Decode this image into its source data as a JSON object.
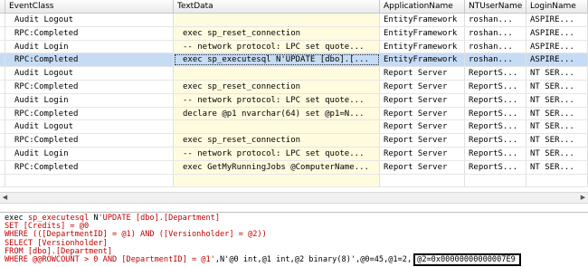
{
  "columns": [
    "EventClass",
    "TextData",
    "ApplicationName",
    "NTUserName",
    "LoginName"
  ],
  "rows": [
    {
      "event": "Audit Logout",
      "text": "",
      "app": "EntityFramework",
      "user": "roshan...",
      "login": "ASPIRE..."
    },
    {
      "event": "RPC:Completed",
      "text": "exec sp_reset_connection",
      "app": "EntityFramework",
      "user": "roshan...",
      "login": "ASPIRE..."
    },
    {
      "event": "Audit Login",
      "text": "-- network protocol: LPC  set quote...",
      "app": "EntityFramework",
      "user": "roshan...",
      "login": "ASPIRE..."
    },
    {
      "event": "RPC:Completed",
      "text": "exec sp_executesql N'UPDATE [dbo].[...",
      "app": "EntityFramework",
      "user": "roshan...",
      "login": "ASPIRE..."
    },
    {
      "event": "Audit Logout",
      "text": "",
      "app": "Report Server",
      "user": "ReportS...",
      "login": "NT SER..."
    },
    {
      "event": "RPC:Completed",
      "text": "exec sp_reset_connection",
      "app": "Report Server",
      "user": "ReportS...",
      "login": "NT SER..."
    },
    {
      "event": "Audit Login",
      "text": "-- network protocol: LPC  set quote...",
      "app": "Report Server",
      "user": "ReportS...",
      "login": "NT SER..."
    },
    {
      "event": "RPC:Completed",
      "text": "declare @p1 nvarchar(64)  set @p1=N...",
      "app": "Report Server",
      "user": "ReportS...",
      "login": "NT SER..."
    },
    {
      "event": "Audit Logout",
      "text": "",
      "app": "Report Server",
      "user": "ReportS...",
      "login": "NT SER..."
    },
    {
      "event": "RPC:Completed",
      "text": "exec sp_reset_connection",
      "app": "Report Server",
      "user": "ReportS...",
      "login": "NT SER..."
    },
    {
      "event": "Audit Login",
      "text": "-- network protocol: LPC  set quote...",
      "app": "Report Server",
      "user": "ReportS...",
      "login": "NT SER..."
    },
    {
      "event": "RPC:Completed",
      "text": "exec GetMyRunningJobs @ComputerName...",
      "app": "Report Server",
      "user": "ReportS...",
      "login": "NT SER..."
    },
    {
      "event": "",
      "text": "",
      "app": "",
      "user": "",
      "login": ""
    }
  ],
  "selected_row": 3,
  "scroll": {
    "left_icon": "scroll-left-arrow-icon",
    "right_icon": "scroll-right-arrow-icon",
    "left_glyph": "◀",
    "right_glyph": "▶"
  },
  "detail": {
    "l1_exec": "exec ",
    "l1_proc": "sp_executesql",
    "l1_n": " N",
    "l1_str": "'UPDATE [dbo].[Department]",
    "l2": "SET [Credits] = @0",
    "l3": "WHERE (([DepartmentID] = @1) AND ([Versionholder] = @2))",
    "l4": "SELECT [Versionholder]",
    "l5": "FROM [dbo].[Department]",
    "l6_str": "WHERE @@ROWCOUNT > 0 AND [DepartmentID] = @1'",
    "l6_rest": ",N'@0 int,@1 int,@2 binary(8)',@0=45,@1=2,",
    "l6_box": "@2=0x00000000000007E9"
  },
  "colors": {
    "selection": "#c6dcf5",
    "textdata_bg": "#fffbdf",
    "sql_keyword": "#c00000"
  }
}
